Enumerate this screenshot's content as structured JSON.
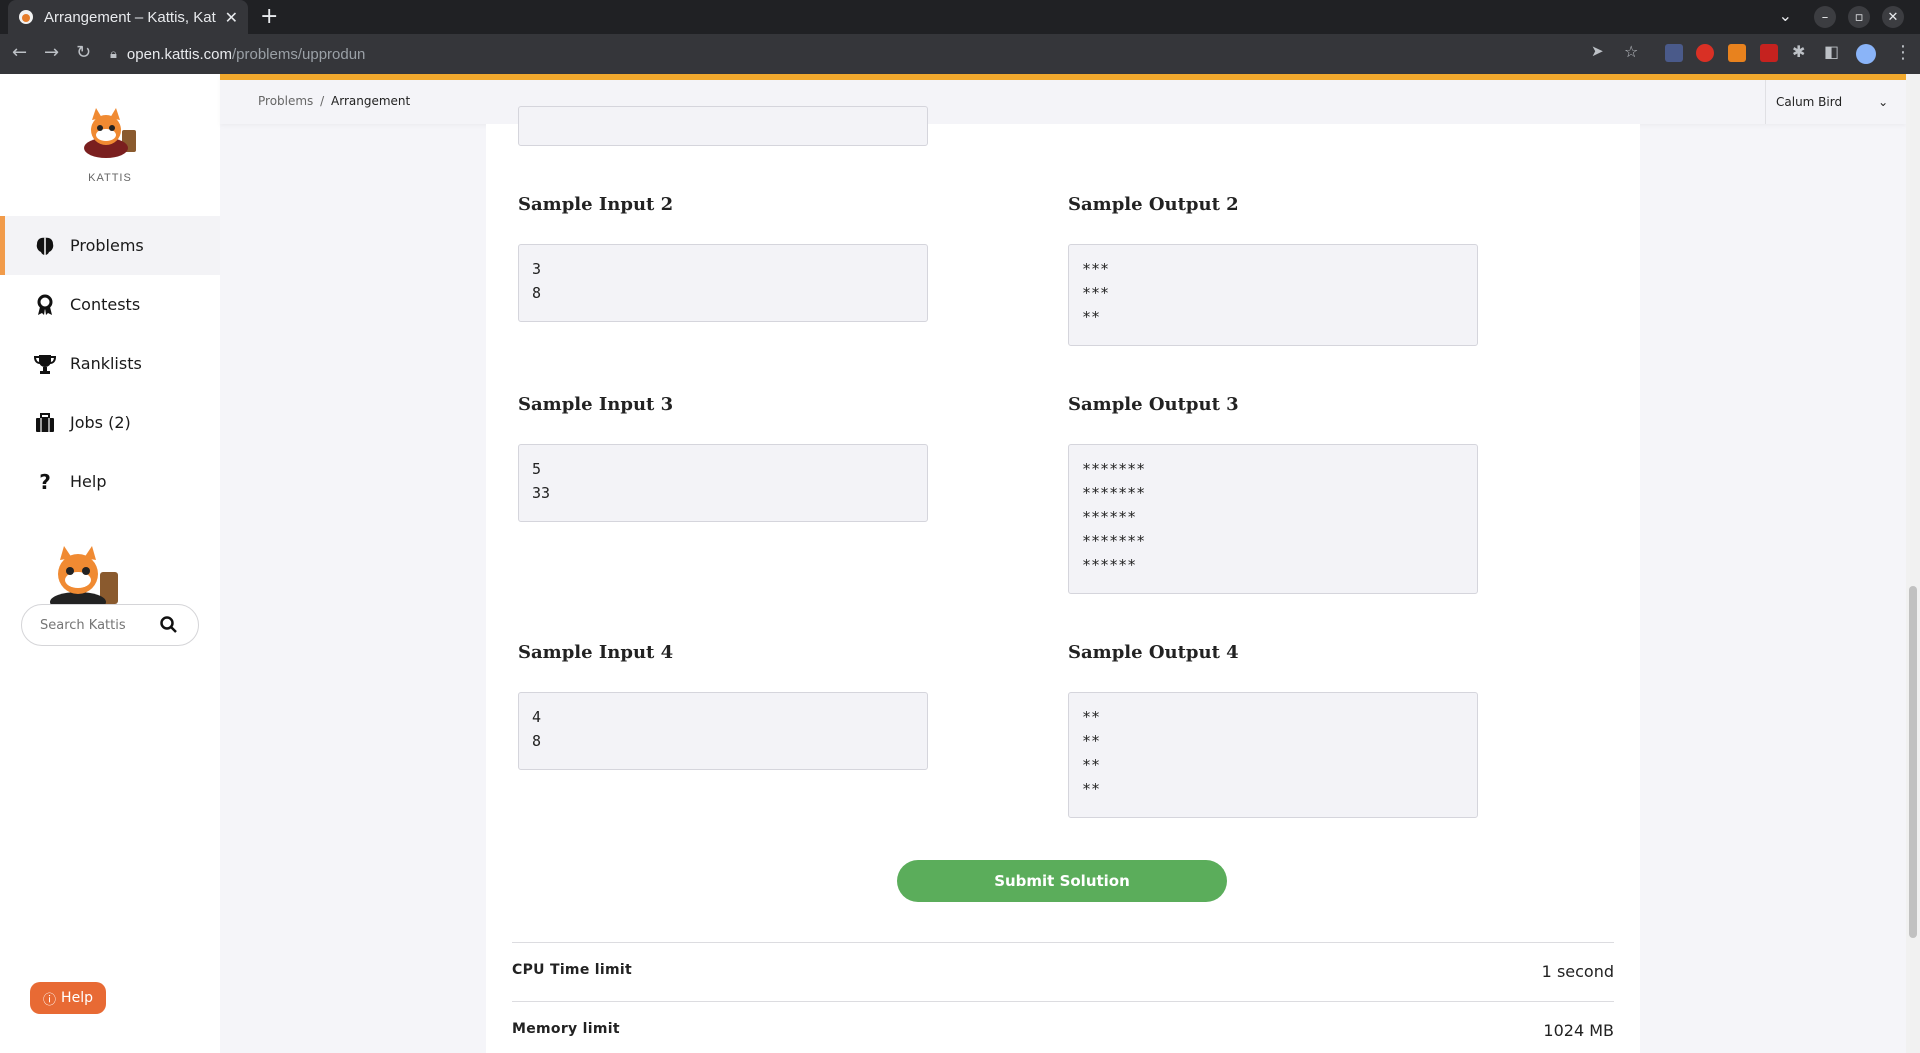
{
  "browser": {
    "tab_title": "Arrangement – Kattis, Kat",
    "close": "✕",
    "new_tab": "+",
    "url_host": "open.kattis.com",
    "url_path": "/problems/upprodun"
  },
  "sidebar": {
    "logo_text": "KATTIS",
    "items": [
      {
        "label": "Problems",
        "icon": "brain-icon"
      },
      {
        "label": "Contests",
        "icon": "award-icon"
      },
      {
        "label": "Ranklists",
        "icon": "trophy-icon"
      },
      {
        "label": "Jobs (2)",
        "icon": "briefcase-icon"
      },
      {
        "label": "Help",
        "icon": "question-icon"
      }
    ],
    "search_placeholder": "Search Kattis",
    "help_button": "Help"
  },
  "header": {
    "breadcrumb_root": "Problems",
    "breadcrumb_sep": "/",
    "breadcrumb_current": "Arrangement",
    "user_name": "Calum Bird"
  },
  "samples": [
    {
      "input_title": "Sample Input 2",
      "input": "3\n8",
      "output_title": "Sample Output 2",
      "output": "***\n***\n**"
    },
    {
      "input_title": "Sample Input 3",
      "input": "5\n33",
      "output_title": "Sample Output 3",
      "output": "*******\n*******\n******\n*******\n******"
    },
    {
      "input_title": "Sample Input 4",
      "input": "4\n8",
      "output_title": "Sample Output 4",
      "output": "**\n**\n**\n**"
    }
  ],
  "submit_label": "Submit Solution",
  "limits": {
    "cpu_label": "CPU Time limit",
    "cpu_value": "1 second",
    "memory_label": "Memory limit",
    "memory_value": "1024 MB"
  },
  "colors": {
    "accent": "#f1a92d",
    "active_marker": "#f19b4a",
    "submit": "#5bad5b",
    "help": "#e86a34"
  }
}
